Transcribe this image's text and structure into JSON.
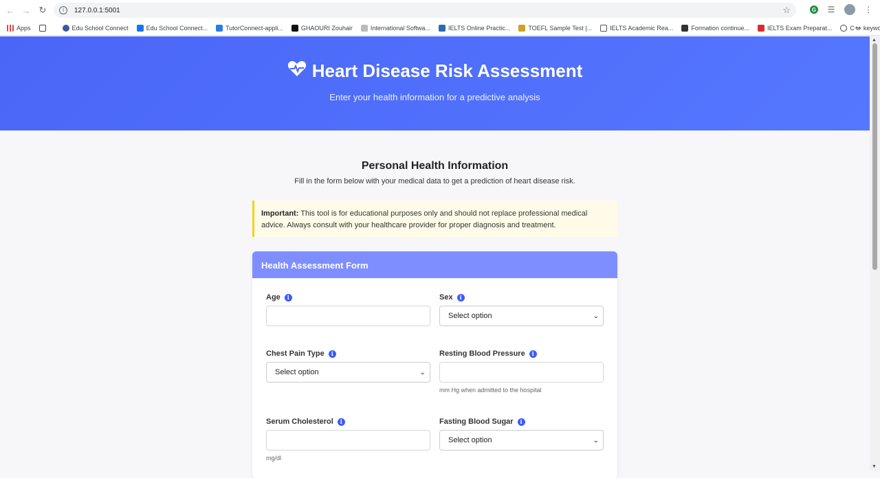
{
  "browser": {
    "url": "127.0.0.1:5001",
    "bookmarks": [
      {
        "label": "Apps",
        "color": "#e8453c"
      },
      {
        "label": "Edu School Connect",
        "color": "#3b5998"
      },
      {
        "label": "Edu School Connect...",
        "color": "#1a73e8"
      },
      {
        "label": "TutorConnect-appli...",
        "color": "#2a7de1"
      },
      {
        "label": "GHAOURI Zouhair",
        "color": "#111111"
      },
      {
        "label": "International Softwa...",
        "color": "#888888"
      },
      {
        "label": "IELTS Online Practic...",
        "color": "#2b6cb0"
      },
      {
        "label": "TOEFL Sample Test |...",
        "color": "#c9a227"
      },
      {
        "label": "IELTS Academic Rea...",
        "color": "#555555"
      },
      {
        "label": "Formation continue...",
        "color": "#333333"
      },
      {
        "label": "IELTS Exam Preparat...",
        "color": "#d32f2f"
      },
      {
        "label": "C++ keywords - cp...",
        "color": "#444444"
      }
    ]
  },
  "hero": {
    "title": "Heart Disease Risk Assessment",
    "subtitle": "Enter your health information for a predictive analysis"
  },
  "section": {
    "title": "Personal Health Information",
    "subtitle": "Fill in the form below with your medical data to get a prediction of heart disease risk."
  },
  "notice": {
    "strong": "Important:",
    "text": " This tool is for educational purposes only and should not replace professional medical advice. Always consult with your healthcare provider for proper diagnosis and treatment."
  },
  "form": {
    "title": "Health Assessment Form",
    "fields": {
      "age": {
        "label": "Age"
      },
      "sex": {
        "label": "Sex",
        "value": "Select option"
      },
      "chest_pain": {
        "label": "Chest Pain Type",
        "value": "Select option"
      },
      "resting_bp": {
        "label": "Resting Blood Pressure",
        "hint": "mm Hg when admitted to the hospital"
      },
      "cholesterol": {
        "label": "Serum Cholesterol",
        "hint": "mg/dl"
      },
      "fasting_sugar": {
        "label": "Fasting Blood Sugar",
        "value": "Select option"
      }
    }
  },
  "colors": {
    "hero": "#4a66f7",
    "card_header": "#7f8eff",
    "notice_border": "#f4d21c",
    "info_icon": "#3d5afe"
  }
}
